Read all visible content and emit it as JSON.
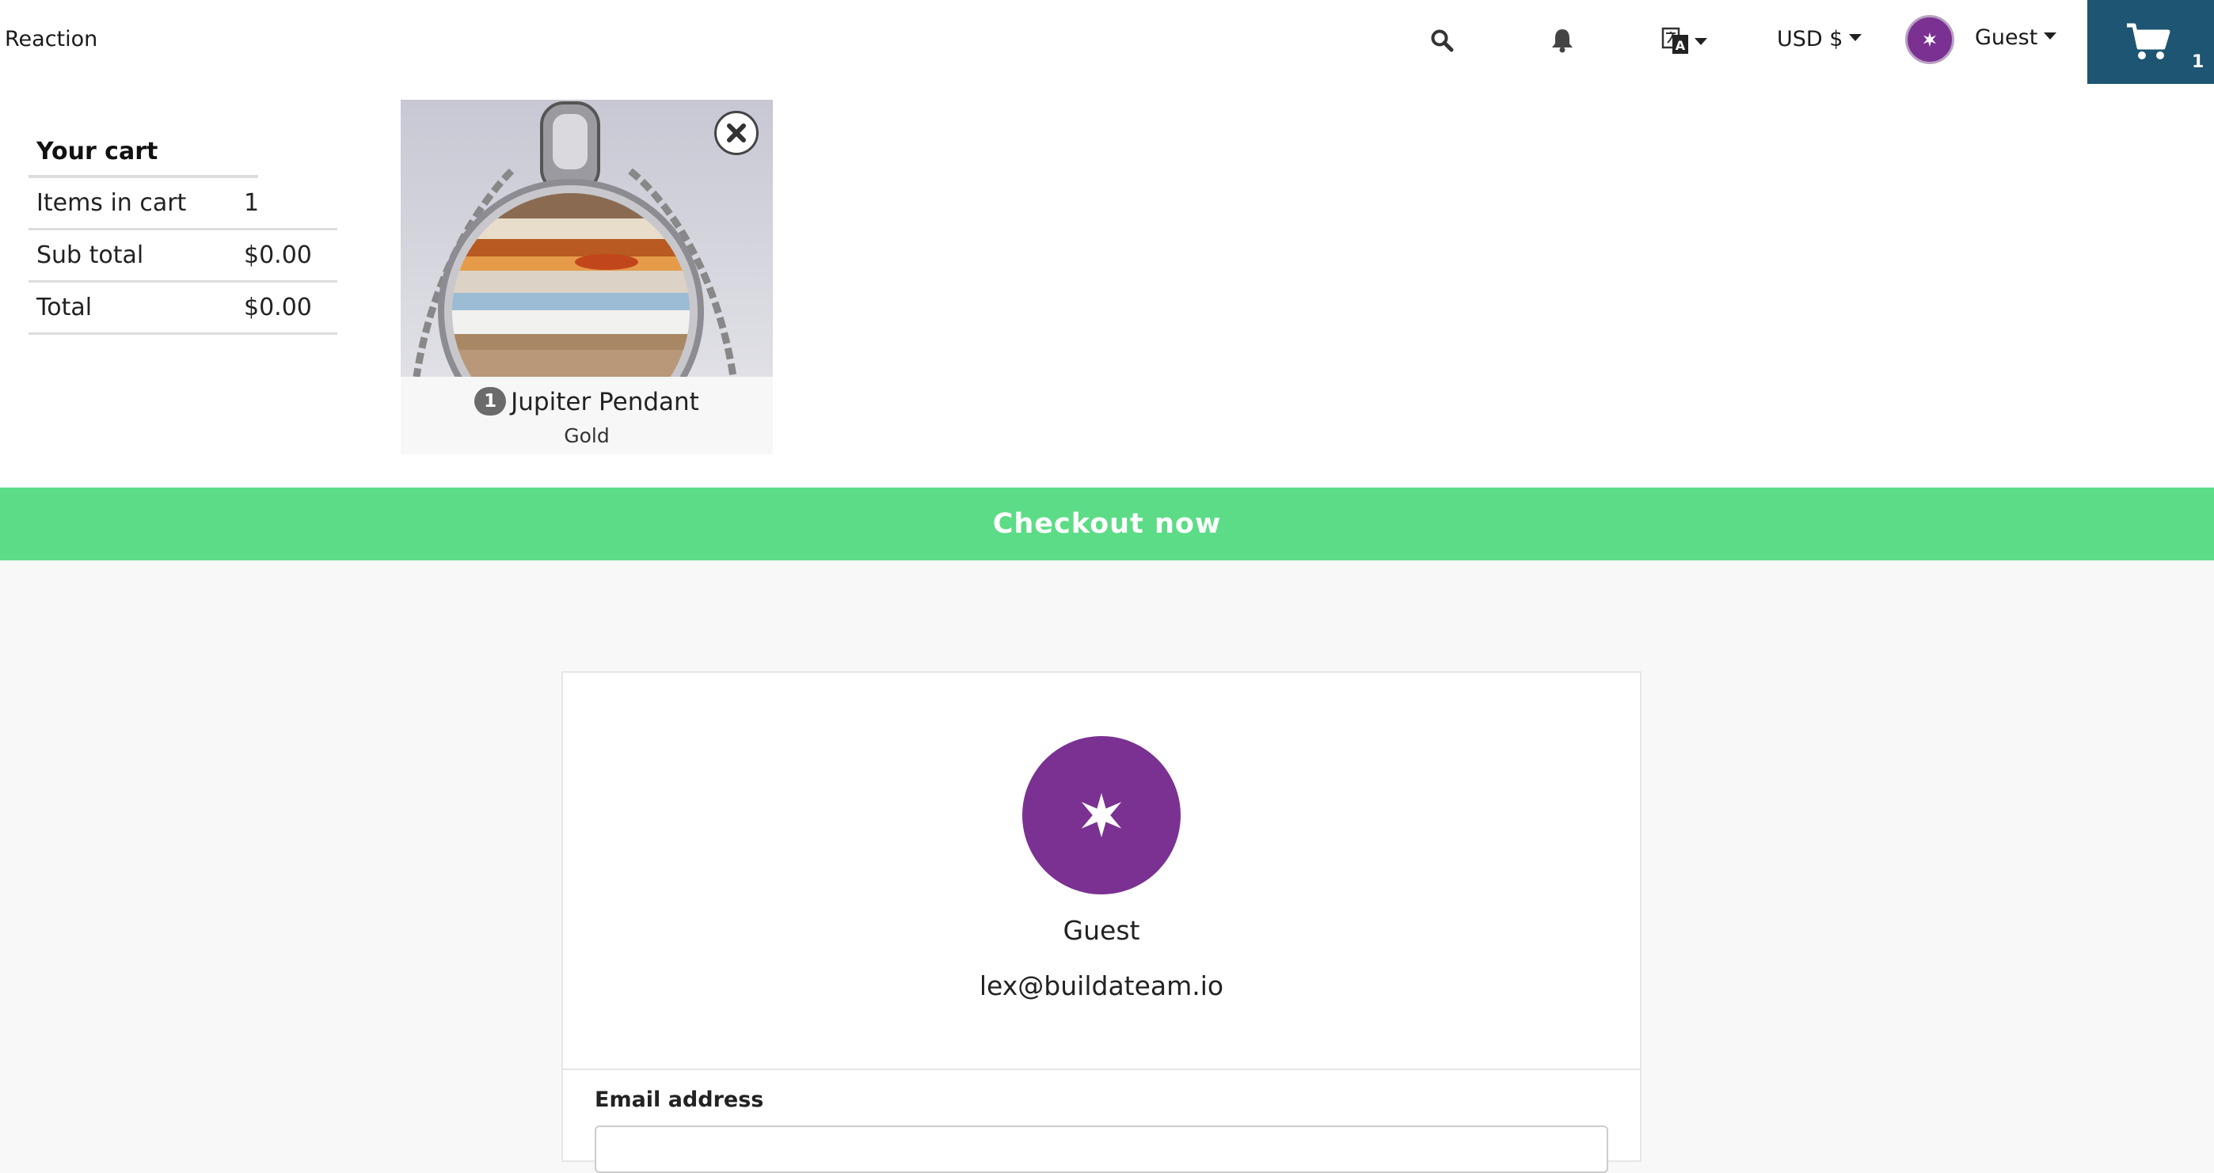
{
  "navbar": {
    "brand": "Reaction",
    "search_icon": "search-icon",
    "notifications_icon": "bell-icon",
    "language_icon": "translate-icon",
    "currency": "USD $",
    "user_label": "Guest",
    "cart_count": "1",
    "cart_bg_color": "#1d5572"
  },
  "cart": {
    "title": "Your cart",
    "rows": [
      {
        "label": "Items in cart",
        "value": "1"
      },
      {
        "label": "Sub total",
        "value": "$0.00"
      },
      {
        "label": "Total",
        "value": "$0.00"
      }
    ],
    "items": [
      {
        "quantity": "1",
        "name": "Jupiter Pendant",
        "variant": "Gold"
      }
    ],
    "checkout_label": "Checkout now",
    "checkout_color": "#5cdc86"
  },
  "account": {
    "name": "Guest",
    "email": "lex@buildateam.io",
    "avatar_color": "#7b3192",
    "email_field_label": "Email address",
    "email_field_value": ""
  }
}
